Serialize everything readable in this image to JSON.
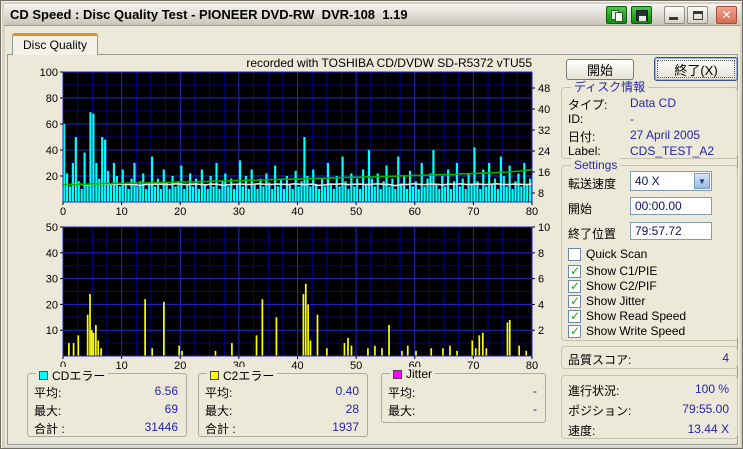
{
  "window": {
    "title": "CD Speed : Disc Quality Test - PIONEER DVD-RW  DVR-108  1.19"
  },
  "tab": {
    "label": "Disc Quality"
  },
  "buttons": {
    "start": "開始",
    "exit": "終了(X)"
  },
  "disc_info": {
    "caption": "ディスク情報",
    "rows": [
      {
        "label": "タイプ:",
        "value": "Data CD"
      },
      {
        "label": "ID:",
        "value": "-"
      },
      {
        "label": "日付:",
        "value": "27 April 2005"
      },
      {
        "label": "Label:",
        "value": "CDS_TEST_A2"
      }
    ]
  },
  "settings": {
    "caption": "Settings",
    "speed_label": "転送速度",
    "speed_value": "40 X",
    "start_label": "開始",
    "start_value": "00:00.00",
    "end_label": "終了位置",
    "end_value": "79:57.72",
    "checkboxes": [
      {
        "label": "Quick Scan",
        "checked": false
      },
      {
        "label": "Show C1/PIE",
        "checked": true
      },
      {
        "label": "Show C2/PIF",
        "checked": true
      },
      {
        "label": "Show Jitter",
        "checked": true
      },
      {
        "label": "Show Read Speed",
        "checked": true
      },
      {
        "label": "Show Write Speed",
        "checked": true
      }
    ]
  },
  "quality": {
    "label": "品質スコア:",
    "value": "4"
  },
  "progress": {
    "rows": [
      {
        "label": "進行状況:",
        "value": "100 %"
      },
      {
        "label": "ポジション:",
        "value": "79:55.00"
      },
      {
        "label": "速度:",
        "value": "13.44 X"
      }
    ]
  },
  "stats": [
    {
      "caption": "CDエラー",
      "color": "#00FFFF",
      "rows": [
        {
          "label": "平均:",
          "value": "6.56"
        },
        {
          "label": "最大:",
          "value": "69"
        },
        {
          "label": "合計 :",
          "value": "31446"
        }
      ]
    },
    {
      "caption": "C2エラー",
      "color": "#FFFF00",
      "rows": [
        {
          "label": "平均:",
          "value": "0.40"
        },
        {
          "label": "最大:",
          "value": "28"
        },
        {
          "label": "合計 :",
          "value": "1937"
        }
      ]
    },
    {
      "caption": "Jitter",
      "color": "#FF00FF",
      "rows": [
        {
          "label": "平均:",
          "value": "-"
        },
        {
          "label": "最大:",
          "value": "-"
        }
      ]
    }
  ],
  "chart_data": [
    {
      "type": "area",
      "title": "recorded with TOSHIBA CD/DVDW SD-R5372 vTU55",
      "x_axis": {
        "range": [
          0,
          80
        ],
        "ticks": [
          0,
          10,
          20,
          30,
          40,
          50,
          60,
          70,
          80
        ]
      },
      "left_axis": {
        "range": [
          0,
          100
        ],
        "ticks": [
          100,
          80,
          60,
          40,
          20
        ]
      },
      "right_axis": {
        "ticks": [
          48,
          40,
          32,
          24,
          16,
          8
        ]
      },
      "grid": true,
      "series": [
        {
          "name": "C1/PIE errors",
          "color": "#00FFFF",
          "values": [
            60,
            22,
            12,
            30,
            50,
            16,
            10,
            38,
            14,
            69,
            68,
            30,
            18,
            50,
            48,
            24,
            14,
            30,
            20,
            12,
            25,
            15,
            10,
            18,
            30,
            12,
            16,
            22,
            10,
            14,
            35,
            12,
            18,
            10,
            25,
            15,
            10,
            20,
            12,
            16,
            28,
            10,
            14,
            22,
            12,
            18,
            10,
            25,
            14,
            10,
            20,
            12,
            30,
            10,
            16,
            22,
            12,
            18,
            10,
            14,
            32,
            12,
            20,
            10,
            25,
            14,
            10,
            18,
            12,
            22,
            15,
            10,
            28,
            12,
            18,
            10,
            20,
            14,
            10,
            24,
            12,
            16,
            50,
            20,
            12,
            25,
            14,
            10,
            18,
            12,
            30,
            14,
            10,
            20,
            12,
            35,
            16,
            10,
            22,
            12,
            18,
            10,
            25,
            14,
            40,
            18,
            12,
            22,
            10,
            16,
            28,
            12,
            18,
            10,
            35,
            14,
            20,
            10,
            24,
            12,
            16,
            10,
            30,
            12,
            18,
            22,
            40,
            14,
            10,
            20,
            12,
            25,
            10,
            16,
            30,
            12,
            18,
            10,
            22,
            14,
            42,
            16,
            10,
            25,
            12,
            30,
            14,
            18,
            10,
            35,
            20,
            12,
            28,
            10,
            16,
            22,
            12,
            30,
            14,
            18
          ]
        },
        {
          "name": "Write Speed",
          "color": "#E4E4E4",
          "axis": "right",
          "values": [
            11.3,
            11.2,
            11.4,
            11.3,
            11.1,
            11.4,
            11.3,
            11.5,
            11.2,
            11.3,
            11.4,
            11.2,
            11.3,
            10.8,
            11.3,
            11.2,
            11.4,
            11.3,
            11.2,
            11.5,
            11.3,
            11.2,
            11.4,
            11.3,
            11.1,
            11.4,
            11.3,
            10.9,
            11.2,
            11.3,
            11.4,
            11.2,
            11.3,
            11.5,
            11.3,
            11.2,
            11.4,
            11.3,
            11.2,
            11.5,
            11.3,
            11.2,
            11.4,
            10.9,
            11.1,
            11.4,
            11.3,
            11.5,
            11.2,
            11.3,
            11.4,
            11.2,
            11.3,
            11.5,
            11.3,
            11.2,
            10.8,
            11.3,
            11.2,
            11.5,
            11.3,
            11.2,
            11.4,
            11.3,
            11.1,
            11.4,
            11.3,
            11.5,
            11.2,
            11.3,
            11.4,
            11.2,
            11.3,
            11.5,
            11.3,
            11.2,
            11.4,
            11.3,
            11.2,
            11.4
          ]
        },
        {
          "name": "Read Speed",
          "color": "#00B400",
          "axis": "right",
          "values": [
            11.2,
            11.3,
            11.2,
            11.4,
            11.3,
            11.5,
            11.4,
            11.6,
            11.5,
            11.7,
            11.6,
            11.8,
            11.7,
            11.9,
            11.8,
            12.0,
            11.9,
            12.1,
            12.0,
            12.2,
            12.1,
            12.3,
            12.2,
            12.4,
            12.3,
            12.5,
            12.5,
            12.6,
            12.6,
            12.8,
            12.7,
            12.9,
            12.8,
            13.0,
            13.0,
            13.1,
            13.1,
            13.3,
            13.2,
            13.4,
            13.3,
            13.5,
            13.5,
            13.6,
            13.6,
            13.8,
            13.7,
            13.9,
            13.9,
            14.0,
            14.0,
            14.2,
            14.1,
            14.3,
            14.3,
            14.4,
            14.4,
            14.6,
            14.5,
            14.7,
            14.7,
            14.8,
            14.8,
            15.0,
            15.0,
            15.1,
            15.1,
            15.3,
            15.3,
            15.4,
            15.5,
            15.6,
            15.6,
            15.8,
            15.9,
            16.0,
            16.2,
            16.4,
            16.6,
            16.9
          ]
        }
      ]
    },
    {
      "type": "bar",
      "x_axis": {
        "range": [
          0,
          80
        ],
        "ticks": [
          0,
          10,
          20,
          30,
          40,
          50,
          60,
          70,
          80
        ]
      },
      "left_axis": {
        "range": [
          0,
          50
        ],
        "ticks": [
          50,
          40,
          30,
          20,
          10
        ]
      },
      "right_axis": {
        "ticks": [
          10,
          8,
          6,
          4,
          2
        ]
      },
      "grid": true,
      "series": [
        {
          "name": "C2/PIF errors",
          "color": "#FFFF00",
          "points": [
            [
              1.0,
              5
            ],
            [
              1.8,
              5
            ],
            [
              2.6,
              8
            ],
            [
              4.2,
              16
            ],
            [
              4.6,
              24
            ],
            [
              4.9,
              10
            ],
            [
              5.2,
              9
            ],
            [
              5.6,
              12
            ],
            [
              6.0,
              6
            ],
            [
              6.5,
              3
            ],
            [
              14.0,
              22
            ],
            [
              15.2,
              3
            ],
            [
              17.2,
              21
            ],
            [
              19.8,
              4
            ],
            [
              20.3,
              2
            ],
            [
              26.0,
              2
            ],
            [
              28.8,
              5
            ],
            [
              33.0,
              8
            ],
            [
              34.0,
              22
            ],
            [
              36.4,
              15
            ],
            [
              41.0,
              24
            ],
            [
              41.4,
              28
            ],
            [
              41.8,
              20
            ],
            [
              42.2,
              6
            ],
            [
              43.4,
              16
            ],
            [
              45.0,
              3
            ],
            [
              48.0,
              5
            ],
            [
              48.6,
              7
            ],
            [
              49.2,
              4
            ],
            [
              52.0,
              3
            ],
            [
              53.2,
              4
            ],
            [
              54.4,
              3
            ],
            [
              55.6,
              12
            ],
            [
              57.8,
              2
            ],
            [
              58.8,
              4
            ],
            [
              60.2,
              2
            ],
            [
              62.8,
              3
            ],
            [
              64.8,
              3
            ],
            [
              66.0,
              4
            ],
            [
              67.2,
              2
            ],
            [
              69.8,
              6
            ],
            [
              70.4,
              3
            ],
            [
              71.0,
              8
            ],
            [
              71.6,
              9
            ],
            [
              72.2,
              3
            ],
            [
              75.8,
              13
            ],
            [
              76.2,
              14
            ],
            [
              77.8,
              4
            ],
            [
              79.0,
              2
            ]
          ]
        }
      ]
    }
  ]
}
